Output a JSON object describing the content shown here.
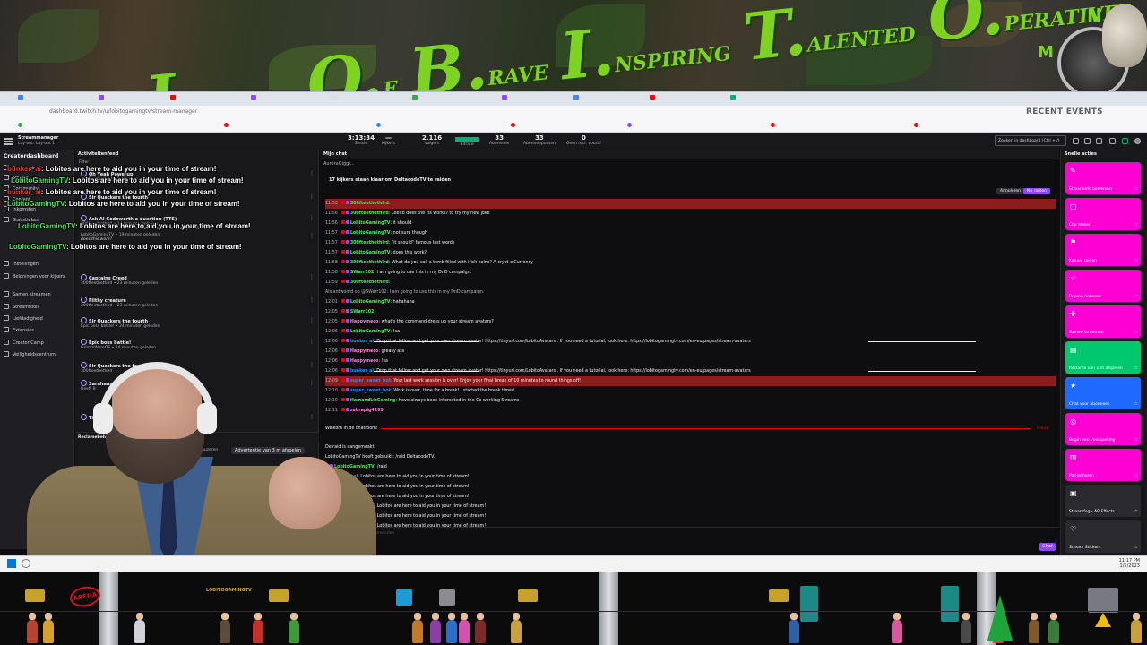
{
  "banner": {
    "letters": [
      {
        "big": "L.",
        "small": "EAGUE"
      },
      {
        "big": "O.",
        "small": "F"
      },
      {
        "big": "B.",
        "small": "RAVE"
      },
      {
        "big": "I.",
        "small": "NSPIRING"
      },
      {
        "big": "T.",
        "small": "ALENTED"
      },
      {
        "big": "O.",
        "small": "PERATIVES"
      }
    ],
    "compass_letters": [
      "N",
      "M"
    ]
  },
  "browser": {
    "recent_events": "RECENT EVENTS",
    "url": "dashboard.twitch.tv/u/lobitogamingtv/stream-manager"
  },
  "topbar": {
    "title": "Streammanager",
    "subtitle": "Lay-out: Lay-out 1",
    "search_placeholder": "Zoeken in dashboard (Ctrl + /)",
    "stats": [
      {
        "value": "3:13:34",
        "label": "Sessie"
      },
      {
        "value": "—",
        "label": "Kijkers"
      },
      {
        "value": "2.116",
        "label": "Volgers"
      },
      {
        "value": "",
        "label": "Bitrate"
      },
      {
        "value": "33",
        "label": "Abonnees"
      },
      {
        "value": "33",
        "label": "Abonneepunten"
      },
      {
        "value": "0",
        "label": "Geen recl. vooraf"
      }
    ],
    "bitrate_color": "#00b173"
  },
  "leftnav": {
    "title": "Creatordashboard",
    "items": [
      "Startpagina",
      "Stream",
      "Community",
      "Content",
      "Inkomsten",
      "Statistieken",
      "Instellingen",
      "Beloningen voor kijkers",
      "Samen streamen",
      "Streamtools",
      "Liefdadigheid",
      "Extensies",
      "Creator Camp",
      "Veiligheidscentrum"
    ]
  },
  "activity": {
    "title": "Activiteitenfeed",
    "filter": "Filter",
    "events": [
      {
        "title": "Oh Yeah Powerup",
        "meta": "300fteethethird • 8 minuten geleden",
        "quote": ""
      },
      {
        "title": "Sir Quackers the fourth",
        "meta": "",
        "quote": ""
      },
      {
        "title": "Ask AI Codeworth a question (TTS)",
        "meta": "300fteethethird • 14 minuten geleden",
        "quote": "What do you call a tomb filled with irish coins? A crypt o'Currency"
      },
      {
        "title": "",
        "meta": "LobitoGamingTV • 19 minuten geleden",
        "quote": "does this work?"
      },
      {
        "title": "Captains Creed",
        "meta": "300fteethethird • 23 minuten geleden",
        "quote": ""
      },
      {
        "title": "Filthy creature",
        "meta": "300fteethethird • 23 minuten geleden",
        "quote": ""
      },
      {
        "title": "Sir Quackers the fourth",
        "meta": "Epic boss battle! • 24 minuten geleden",
        "quote": ""
      },
      {
        "title": "Epic boss battle!",
        "meta": "GrimmWareOS • 24 minuten geleden",
        "quote": ""
      },
      {
        "title": "Sir Quackers the fourth",
        "meta": "300fteethethird",
        "quote": ""
      },
      {
        "title": "Saraham",
        "meta": "Heeft B",
        "quote": ""
      },
      {
        "title": "Tie",
        "meta": "",
        "quote": ""
      }
    ],
    "ads_title": "Reclamebeheer",
    "ads_button": "Advertentie van 3 m afspelen",
    "ads_pause": "3 pauzeren"
  },
  "overlay_chat": [
    {
      "user": "bunker_ai",
      "text": "Lobitos are here to aid you in your time of stream!",
      "green": false
    },
    {
      "user": "LobitoGamingTV",
      "text": "Lobitos are here to aid you in your time of stream!",
      "green": true
    },
    {
      "user": "bunker_ai",
      "text": "Lobitos are here to aid you in your time of stream!",
      "green": false
    },
    {
      "user": "LobitoGamingTV",
      "text": "Lobitos are here to aid you in your time of stream!",
      "green": true
    },
    {
      "user": "LobitoGamingTV",
      "text": "Lobitos are here to aid you in your time of stream!",
      "green": true
    },
    {
      "user": "LobitoGamingTV",
      "text": "Lobitos are here to aid you in your time of stream!",
      "green": true
    }
  ],
  "chat": {
    "title": "Mijn chat",
    "pinned": "AuroraGiggl...",
    "raid_banner": "17 kijkers staan klaar om DeltacodeTV te raiden",
    "raid_cancel": "Annuleren",
    "raid_now": "Nu raiden",
    "new_label": "Nieuw",
    "input_placeholder": "Bericht verzenden",
    "send_button": "Chat",
    "messages": [
      {
        "ts": "11:53",
        "user": "300fteethethird",
        "color": "#3df05a",
        "text": "",
        "hl": true
      },
      {
        "ts": "11:56",
        "user": "300fteethethird",
        "color": "#3df05a",
        "text": "Lobito does the tts works? to try my new joke"
      },
      {
        "ts": "11:56",
        "user": "LobitoGamingTV",
        "color": "#3df05a",
        "text": "it should"
      },
      {
        "ts": "11:57",
        "user": "LobitoGamingTV",
        "color": "#3df05a",
        "text": "not sure though"
      },
      {
        "ts": "11:57",
        "user": "300fteethethird",
        "color": "#3df05a",
        "text": "\"it should\" famous last words"
      },
      {
        "ts": "11:57",
        "user": "LobitoGamingTV",
        "color": "#3df05a",
        "text": "does this work?"
      },
      {
        "ts": "11:58",
        "user": "300fteethethird",
        "color": "#3df05a",
        "text": "What do you call a tomb filled with irish coins? A crypt o'Currency"
      },
      {
        "ts": "11:58",
        "user": "SWarr102",
        "color": "#3df05a",
        "text": "I am going to use this in my DnD campaign."
      },
      {
        "ts": "11:59",
        "user": "300fteethethird",
        "color": "#3df05a",
        "text": ""
      },
      {
        "ts": "",
        "user": "",
        "color": "#adadb8",
        "text": "Als antwoord op @SWarr102: I am going to use this in my DnD campaign."
      },
      {
        "ts": "12:01",
        "user": "LobitoGamingTV",
        "color": "#3df05a",
        "text": "hahahaha"
      },
      {
        "ts": "12:05",
        "user": "SWarr102",
        "color": "#3df05a",
        "text": ""
      },
      {
        "ts": "12:05",
        "user": "Happymeco",
        "color": "#ff7ad9",
        "text": "what's the command dress up your stream avatars?"
      },
      {
        "ts": "12:06",
        "user": "LobitoGamingTV",
        "color": "#3df05a",
        "text": "!sa"
      },
      {
        "ts": "12:06",
        "user": "bunker_ai",
        "color": "#1e90ff",
        "text": "Drop that follow and get your own stream avatar! https://tinyurl.com/LobitoAvatars . If you need a tutorial, look here: https://lobitogamingtv.com/en-eu/pages/stream-avatars",
        "line": true
      },
      {
        "ts": "12:06",
        "user": "Happymeco",
        "color": "#ff7ad9",
        "text": "greasy ass"
      },
      {
        "ts": "12:06",
        "user": "Happymeco",
        "color": "#ff7ad9",
        "text": "!sa"
      },
      {
        "ts": "12:06",
        "user": "bunker_ai",
        "color": "#1e90ff",
        "text": "Drop that follow and get your own stream avatar! https://tinyurl.com/LobitoAvatars . If you need a tutorial, look here: https://lobitogamingtv.com/en-eu/pages/stream-avatars",
        "line": true
      },
      {
        "ts": "12:09",
        "user": "super_sweet_bot",
        "color": "#1e90ff",
        "text": "Your last work session is over! Enjoy your final break of 10 minutes to round things off!",
        "hl": true
      },
      {
        "ts": "12:10",
        "user": "super_sweet_bot",
        "color": "#1e90ff",
        "text": "Work is over, time for a break! I started the break timer!"
      },
      {
        "ts": "12:10",
        "user": "HamandLizGaming",
        "color": "#3df05a",
        "text": "Have always been interested in the Co working Streams"
      },
      {
        "ts": "12:11",
        "user": "zebrapig4299",
        "color": "#ff7ad9",
        "text": ""
      },
      {
        "ts": "",
        "user": "",
        "color": "#efeff1",
        "text": "Welkom in de chatroom!"
      },
      {
        "ts": "",
        "user": "",
        "color": "#efeff1",
        "text": "De raid is aangemaakt."
      },
      {
        "ts": "",
        "user": "",
        "color": "#efeff1",
        "text": "LobitoGamingTV heeft gebruikt: /raid DeltacodeTV."
      },
      {
        "ts": "",
        "user": "LobitoGamingTV",
        "color": "#3df05a",
        "text": "/raid"
      },
      {
        "ts": "",
        "user": "bunker_ai",
        "color": "#1e90ff",
        "text": "Lobitos are here to aid you in your time of stream!"
      },
      {
        "ts": "",
        "user": "bunker_ai",
        "color": "#1e90ff",
        "text": "Lobitos are here to aid you in your time of stream!"
      },
      {
        "ts": "",
        "user": "bunker_ai",
        "color": "#1e90ff",
        "text": "Lobitos are here to aid you in your time of stream!"
      },
      {
        "ts": "",
        "user": "LobitoGamingTV",
        "color": "#3df05a",
        "text": "Lobitos are here to aid you in your time of stream!"
      },
      {
        "ts": "",
        "user": "LobitoGamingTV",
        "color": "#3df05a",
        "text": "Lobitos are here to aid you in your time of stream!"
      },
      {
        "ts": "",
        "user": "LobitoGamingTV",
        "color": "#3df05a",
        "text": "Lobitos are here to aid you in your time of stream!"
      }
    ]
  },
  "quick": {
    "title": "Snelle acties",
    "actions": [
      {
        "label": "Streaminfo bewerken",
        "color": "#ff00d4",
        "icon": "✎"
      },
      {
        "label": "Clip maken",
        "color": "#ff00d4",
        "icon": "▢"
      },
      {
        "label": "Kanaal raiden",
        "color": "#ff00d4",
        "icon": "⚑"
      },
      {
        "label": "Doelen beheren",
        "color": "#ff00d4",
        "icon": "☆"
      },
      {
        "label": "Samen streamen",
        "color": "#ff00d4",
        "icon": "✚"
      },
      {
        "label": "Reclame van 1 m afspelen",
        "color": "#00c86f",
        "icon": "▤"
      },
      {
        "label": "Chat voor abonnees",
        "color": "#1e69ff",
        "icon": "★"
      },
      {
        "label": "Begin een voorspelling",
        "color": "#ff00d4",
        "icon": "◎"
      },
      {
        "label": "Poll beheren",
        "color": "#ff00d4",
        "icon": "▥"
      },
      {
        "label": "Streamfog - AR Effects",
        "color": "#2a2a2e",
        "icon": "▣"
      },
      {
        "label": "Stream Stickers",
        "color": "#2a2a2e",
        "icon": "♡"
      }
    ]
  },
  "game": {
    "arena": "ARENA",
    "channel": "LOBITOGAMINGTV"
  },
  "taskbar": {
    "time": "11:17 PM",
    "date": "1/5/2023"
  }
}
